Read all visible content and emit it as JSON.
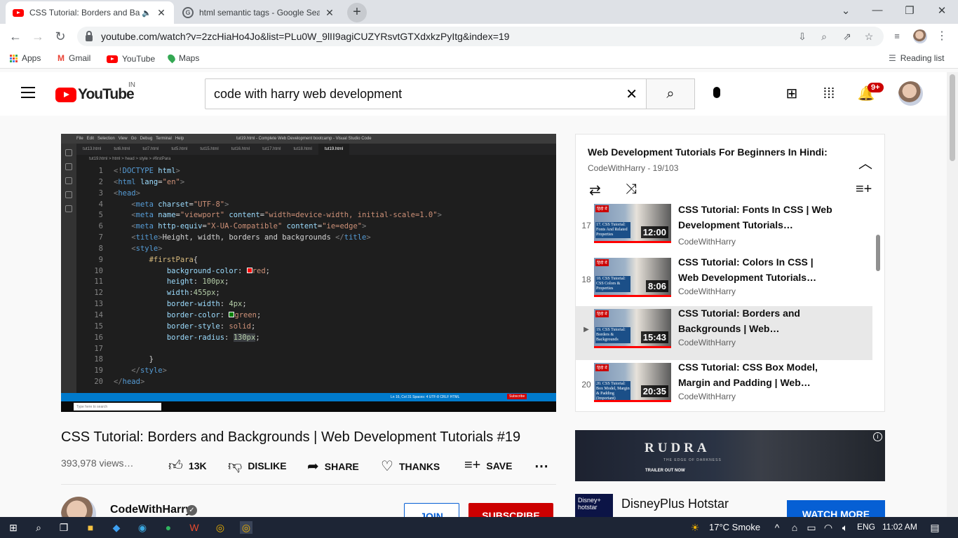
{
  "browser": {
    "tabs": [
      {
        "title": "CSS Tutorial: Borders and Ba",
        "icon": "youtube-icon",
        "audio": true,
        "active": true
      },
      {
        "title": "html semantic tags - Google Sear",
        "icon": "google-icon",
        "active": false
      }
    ],
    "url": "youtube.com/watch?v=2zcHiaHo4Jo&list=PLu0W_9lII9agiCUZYRsvtGTXdxkzPyItg&index=19",
    "bookmarks": [
      "Apps",
      "Gmail",
      "YouTube",
      "Maps"
    ],
    "reading_list": "Reading list"
  },
  "youtube": {
    "region": "IN",
    "search_query": "code with harry web development",
    "notification_count": "9+"
  },
  "editor": {
    "tabs": [
      "tut13.html",
      "tut6.html",
      "tut7.html",
      "tut5.html",
      "tut15.html",
      "tut16.html",
      "tut17.html",
      "tut18.html",
      "tut19.html"
    ],
    "breadcrumb": "tut19.html > html > head > style > #firstPara",
    "title": "tut19.html - Complete Web Development bootcamp - Visual Studio Code",
    "status": "Ln 16, Col 31   Spaces: 4   UTF-8   CRLF   HTML",
    "taskbar_search": "Type here to search",
    "subscribe_watermark": "Subscribe",
    "lines": [
      "1",
      "2",
      "3",
      "4",
      "5",
      "6",
      "7",
      "8",
      "9",
      "10",
      "11",
      "12",
      "13",
      "14",
      "15",
      "16",
      "17",
      "18",
      "19",
      "20"
    ]
  },
  "video": {
    "title": "CSS Tutorial: Borders and Backgrounds | Web Development Tutorials #19",
    "views": "393,978 views…",
    "likes": "13K",
    "dislike": "DISLIKE",
    "share": "SHARE",
    "thanks": "THANKS",
    "save": "SAVE",
    "channel": "CodeWithHarry",
    "join": "JOIN",
    "subscribe": "SUBSCRIBE"
  },
  "playlist": {
    "title": "Web Development Tutorials For Beginners In Hindi:",
    "subtitle": "CodeWithHarry - 19/103",
    "items": [
      {
        "index": "17",
        "title": "CSS Tutorial: Fonts In CSS | Web Development Tutorials…",
        "channel": "CodeWithHarry",
        "duration": "12:00",
        "thumb_label": "17. CSS Tutorial: Fonts And Related Properties"
      },
      {
        "index": "18",
        "title": "CSS Tutorial: Colors In CSS | Web Development Tutorials…",
        "channel": "CodeWithHarry",
        "duration": "8:06",
        "thumb_label": "18. CSS Tutorial: CSS Colors & Properties"
      },
      {
        "index": "▶",
        "title": "CSS Tutorial: Borders and Backgrounds | Web…",
        "channel": "CodeWithHarry",
        "duration": "15:43",
        "thumb_label": "19. CSS Tutorial: Borders & Backgrounds"
      },
      {
        "index": "20",
        "title": "CSS Tutorial: CSS Box Model, Margin and Padding | Web…",
        "channel": "CodeWithHarry",
        "duration": "20:35",
        "thumb_label": "20. CSS Tutorial: Box Model, Margin & Padding (Important)"
      }
    ],
    "thumb_tag": "हिंदी में"
  },
  "ad": {
    "banner_title": "RUDRA",
    "banner_sub": "THE EDGE OF DARKNESS",
    "banner_cta": "TRAILER OUT NOW",
    "logo_text": "Disney+ hotstar",
    "advertiser": "DisneyPlus Hotstar",
    "cta": "WATCH MORE"
  },
  "taskbar": {
    "weather": "17°C  Smoke",
    "lang": "ENG",
    "time": "11:02 AM"
  }
}
